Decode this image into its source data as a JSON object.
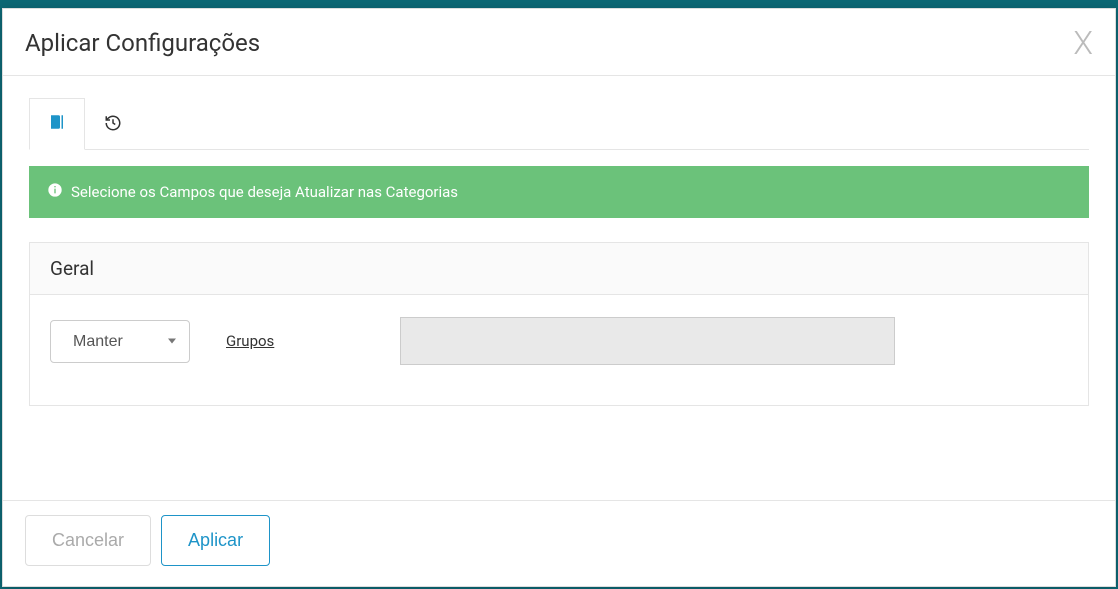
{
  "modal": {
    "title": "Aplicar Configurações",
    "close_label": "X"
  },
  "alert": {
    "message": "Selecione os Campos que deseja Atualizar nas Categorias"
  },
  "panel": {
    "title": "Geral",
    "action_select": {
      "value": "Manter"
    },
    "field_label": "Grupos"
  },
  "footer": {
    "cancel_label": "Cancelar",
    "apply_label": "Aplicar"
  },
  "colors": {
    "alert_bg": "#6bc27a",
    "primary": "#1e94c8",
    "tab_active_icon": "#1e94c8"
  }
}
